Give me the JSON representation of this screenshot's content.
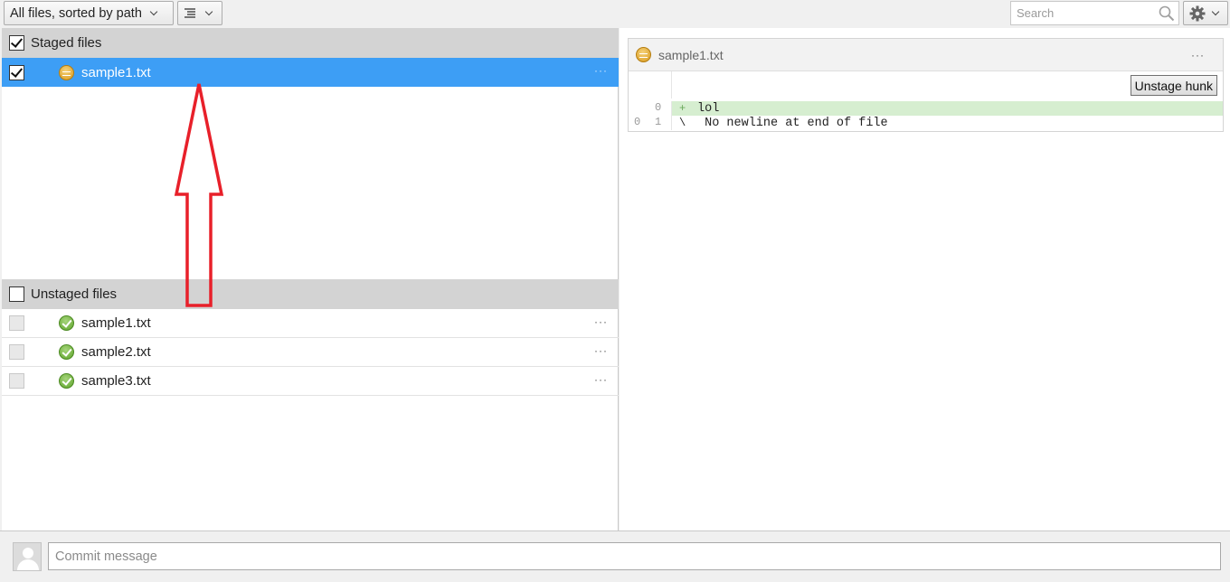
{
  "toolbar": {
    "filter_label": "All files, sorted by path",
    "view_icon": "list-tree-icon",
    "search_placeholder": "Search",
    "settings_icon": "gear-icon"
  },
  "staged": {
    "header": "Staged files",
    "checked": true,
    "files": [
      {
        "name": "sample1.txt",
        "status": "modified",
        "checked": true,
        "selected": true
      }
    ]
  },
  "unstaged": {
    "header": "Unstaged files",
    "checked": false,
    "files": [
      {
        "name": "sample1.txt",
        "status": "clean",
        "checked": false
      },
      {
        "name": "sample2.txt",
        "status": "clean",
        "checked": false
      },
      {
        "name": "sample3.txt",
        "status": "clean",
        "checked": false
      }
    ]
  },
  "more_label": "···",
  "diff": {
    "file_name": "sample1.txt",
    "hunk_button": "Unstage hunk",
    "lines": [
      {
        "old": "",
        "new": "0",
        "marker": "+",
        "text": "lol",
        "type": "added"
      },
      {
        "old": "0",
        "new": "1",
        "marker": "\\",
        "text": " No newline at end of file",
        "type": "context"
      }
    ]
  },
  "commit": {
    "placeholder": "Commit message"
  },
  "annotation": {
    "color": "#e8202a",
    "shape": "up-arrow"
  }
}
